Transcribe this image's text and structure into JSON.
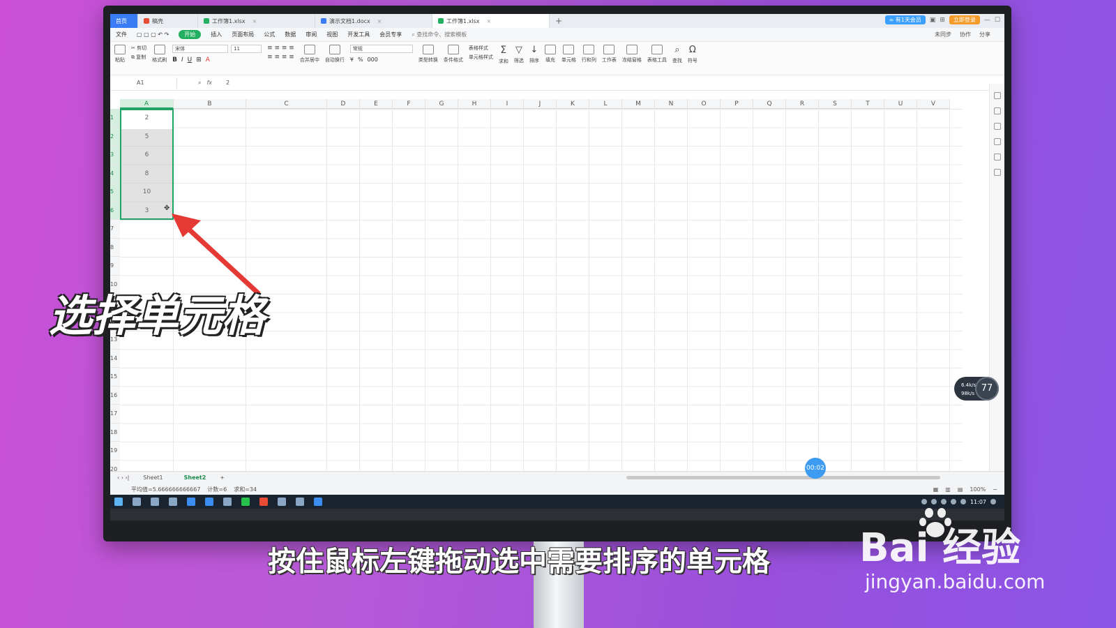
{
  "tabs": [
    {
      "label": "首页",
      "type": "home"
    },
    {
      "label": "稿壳",
      "type": "normal",
      "color": "#e94b35"
    },
    {
      "label": "工作簿1.xlsx",
      "type": "normal",
      "color": "#22b060"
    },
    {
      "label": "演示文档1.docx",
      "type": "normal",
      "color": "#3a7cf5"
    },
    {
      "label": "工作簿1.xlsx",
      "type": "active",
      "color": "#22b060"
    }
  ],
  "tab_right": {
    "badge": "∞ 有1天会员",
    "user": "立即登录"
  },
  "menu": {
    "items": [
      "文件",
      "开始",
      "插入",
      "页面布局",
      "公式",
      "数据",
      "审阅",
      "视图",
      "开发工具",
      "会员专享"
    ],
    "active": "开始",
    "search": "查找命令、搜索模板",
    "right": [
      "未同步",
      "协作",
      "分享"
    ]
  },
  "ribbon": {
    "clipboard": [
      "粘贴",
      "剪切",
      "复制",
      "格式刷"
    ],
    "font_name": "宋体",
    "font_size": "11",
    "font_buttons": [
      "B",
      "I",
      "U",
      "A"
    ],
    "merge": "合并居中",
    "wrap": "自动换行",
    "number_format": "常规",
    "type_convert": "类型转换",
    "groups": [
      "条件格式",
      "表格样式",
      "单元格样式",
      "求和",
      "筛选",
      "排序",
      "填充",
      "单元格",
      "行和列",
      "工作表",
      "冻结窗格",
      "表格工具",
      "查找",
      "符号"
    ]
  },
  "formula_bar": {
    "cell_ref": "A1",
    "fx": "fx",
    "value": "2"
  },
  "columns": [
    "A",
    "B",
    "C",
    "D",
    "E",
    "F",
    "G",
    "H",
    "I",
    "J",
    "K",
    "L",
    "M",
    "N",
    "O",
    "P",
    "Q",
    "R",
    "S",
    "T",
    "U",
    "V"
  ],
  "rows": [
    "1",
    "2",
    "3",
    "4",
    "5",
    "6",
    "7",
    "8",
    "9",
    "10",
    "11",
    "12",
    "13",
    "14",
    "15",
    "16",
    "17",
    "18",
    "19",
    "20"
  ],
  "selected_values": [
    "2",
    "5",
    "6",
    "8",
    "10",
    "3"
  ],
  "sheets": [
    "Sheet1",
    "Sheet2"
  ],
  "active_sheet": "Sheet2",
  "status": {
    "avg": "平均值=5.666666666667",
    "count": "计数=6",
    "sum": "求和=34",
    "zoom": "100%"
  },
  "taskbar_time": "11:07",
  "overlay": {
    "timer": "00:02",
    "net_up": "6.4k/s",
    "net_down": "98k/s",
    "cpu": "77"
  },
  "caption_big": "选择单元格",
  "subtitle": "按住鼠标左键拖动选中需要排序的单元格",
  "watermark": {
    "brand": "Bai  经验",
    "url": "jingyan.baidu.com"
  },
  "colors": {
    "accent": "#21a366",
    "caption_arrow": "#e53935"
  }
}
